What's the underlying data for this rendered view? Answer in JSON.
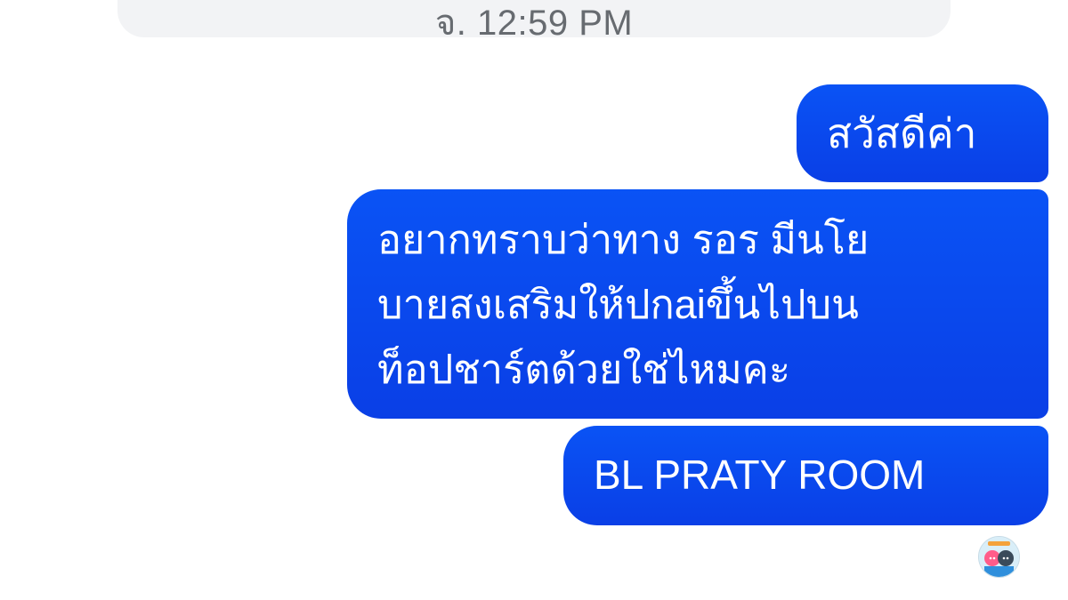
{
  "thread": {
    "timestamp": "จ. 12:59 PM"
  },
  "messages": [
    {
      "lines": [
        "สวัสดีค่า"
      ]
    },
    {
      "lines": [
        "อยากทราบว่าทาง รอร มีนโย",
        "บายสงเสริมให้ปกaiขึ้นไปบน",
        "ท็อปชาร์ตด้วยใช่ไหมคะ"
      ]
    },
    {
      "lines": [
        "BL PRATY ROOM"
      ]
    }
  ],
  "colors": {
    "bubble_start": "#0a53f5",
    "bubble_end": "#0a3fe6",
    "bubble_text": "#ffffff",
    "timestamp_text": "#676b70",
    "timestamp_pill": "#f2f3f5",
    "background": "#ffffff"
  },
  "icons": {
    "read_receipt": "avatar-icon"
  }
}
